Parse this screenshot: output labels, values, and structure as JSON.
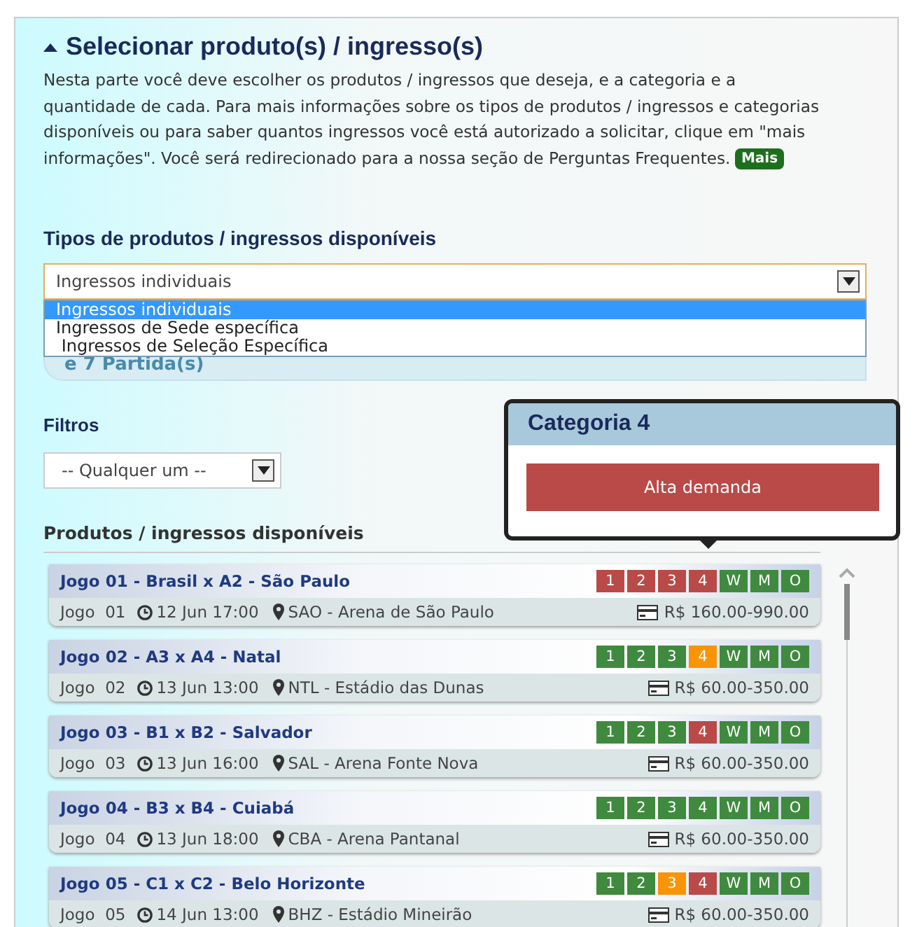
{
  "section": {
    "title": "Selecionar produto(s) / ingresso(s)",
    "expanded": true,
    "intro": "Nesta parte você deve escolher os produtos / ingressos que deseja, e a categoria e a quantidade de cada. Para mais informações sobre os tipos de produtos / ingressos e categorias disponíveis ou para saber quantos ingressos você está autorizado a solicitar, clique em \"mais informações\". Você será redirecionado para a nossa seção de Perguntas Frequentes.",
    "more_button": "Mais"
  },
  "product_types": {
    "label": "Tipos de produtos / ingressos disponíveis",
    "value": "Ingressos individuais",
    "options": [
      {
        "label": "Ingressos individuais",
        "selected": true
      },
      {
        "label": "Ingressos de Sede específica",
        "selected": false
      },
      {
        "label": " Ingressos de Seleção Específica",
        "selected": false
      }
    ],
    "panel_text": "e 7 Partida(s)"
  },
  "filters": {
    "label": "Filtros",
    "value": "-- Qualquer um --"
  },
  "products": {
    "heading": "Produtos / ingressos disponíveis",
    "matches": [
      {
        "title": "Jogo 01 - Brasil x A2 - São Paulo",
        "number_label": "Jogo",
        "number": "01",
        "datetime": "12 Jun 17:00",
        "venue": "SAO - Arena de São Paulo",
        "price": "R$ 160.00-990.00",
        "categories": [
          {
            "label": "1",
            "color": "#b94a48"
          },
          {
            "label": "2",
            "color": "#b94a48"
          },
          {
            "label": "3",
            "color": "#b94a48"
          },
          {
            "label": "4",
            "color": "#b94a48"
          },
          {
            "label": "W",
            "color": "#3f8a3f"
          },
          {
            "label": "M",
            "color": "#3f8a3f"
          },
          {
            "label": "O",
            "color": "#3f8a3f"
          }
        ]
      },
      {
        "title": "Jogo 02 - A3 x A4 - Natal",
        "number_label": "Jogo",
        "number": "02",
        "datetime": "13 Jun 13:00",
        "venue": "NTL - Estádio das Dunas",
        "price": "R$ 60.00-350.00",
        "categories": [
          {
            "label": "1",
            "color": "#3f8a3f"
          },
          {
            "label": "2",
            "color": "#3f8a3f"
          },
          {
            "label": "3",
            "color": "#3f8a3f"
          },
          {
            "label": "4",
            "color": "#f89406"
          },
          {
            "label": "W",
            "color": "#3f8a3f"
          },
          {
            "label": "M",
            "color": "#3f8a3f"
          },
          {
            "label": "O",
            "color": "#3f8a3f"
          }
        ]
      },
      {
        "title": "Jogo 03 - B1 x B2 - Salvador",
        "number_label": "Jogo",
        "number": "03",
        "datetime": "13 Jun 16:00",
        "venue": "SAL - Arena Fonte Nova",
        "price": "R$ 60.00-350.00",
        "categories": [
          {
            "label": "1",
            "color": "#3f8a3f"
          },
          {
            "label": "2",
            "color": "#3f8a3f"
          },
          {
            "label": "3",
            "color": "#3f8a3f"
          },
          {
            "label": "4",
            "color": "#b94a48"
          },
          {
            "label": "W",
            "color": "#3f8a3f"
          },
          {
            "label": "M",
            "color": "#3f8a3f"
          },
          {
            "label": "O",
            "color": "#3f8a3f"
          }
        ]
      },
      {
        "title": "Jogo 04 - B3 x B4 - Cuiabá",
        "number_label": "Jogo",
        "number": "04",
        "datetime": "13 Jun 18:00",
        "venue": "CBA - Arena Pantanal",
        "price": "R$ 60.00-350.00",
        "categories": [
          {
            "label": "1",
            "color": "#3f8a3f"
          },
          {
            "label": "2",
            "color": "#3f8a3f"
          },
          {
            "label": "3",
            "color": "#3f8a3f"
          },
          {
            "label": "4",
            "color": "#3f8a3f"
          },
          {
            "label": "W",
            "color": "#3f8a3f"
          },
          {
            "label": "M",
            "color": "#3f8a3f"
          },
          {
            "label": "O",
            "color": "#3f8a3f"
          }
        ]
      },
      {
        "title": "Jogo 05 - C1 x C2 - Belo Horizonte",
        "number_label": "Jogo",
        "number": "05",
        "datetime": "14 Jun 13:00",
        "venue": "BHZ - Estádio Mineirão",
        "price": "R$ 60.00-350.00",
        "categories": [
          {
            "label": "1",
            "color": "#3f8a3f"
          },
          {
            "label": "2",
            "color": "#3f8a3f"
          },
          {
            "label": "3",
            "color": "#f89406"
          },
          {
            "label": "4",
            "color": "#b94a48"
          },
          {
            "label": "W",
            "color": "#3f8a3f"
          },
          {
            "label": "M",
            "color": "#3f8a3f"
          },
          {
            "label": "O",
            "color": "#3f8a3f"
          }
        ]
      }
    ]
  },
  "tooltip": {
    "title": "Categoria 4",
    "status": "Alta demanda"
  }
}
